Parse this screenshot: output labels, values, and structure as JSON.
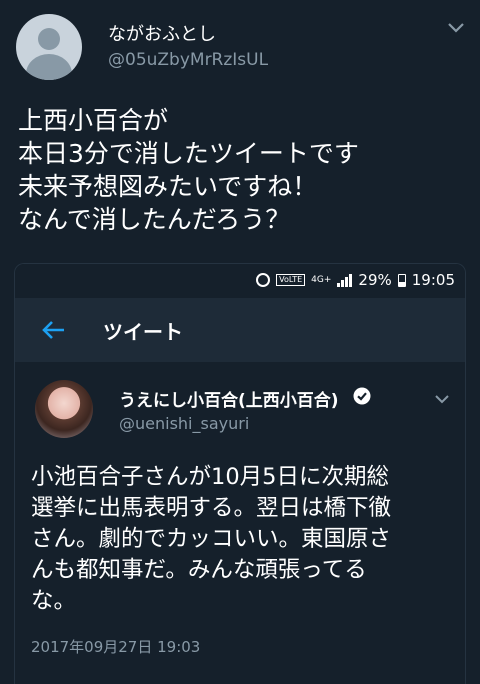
{
  "tweet": {
    "display_name": "ながおふとし",
    "handle": "@05uZbyMrRzIsUL",
    "text_lines": [
      "上西小百合が",
      "本日3分で消したツイートです",
      "未来予想図みたいですね！",
      "なんで消したんだろう？"
    ],
    "avatar_icon": "default-profile-icon",
    "menu_icon": "chevron-down-icon"
  },
  "screenshot": {
    "status_bar": {
      "volte": "VoLTE",
      "network": "4G+",
      "battery": "29%",
      "time": "19:05"
    },
    "app_bar": {
      "title": "ツイート",
      "back_icon": "arrow-left-icon"
    },
    "inner_tweet": {
      "display_name": "うえにし小百合(上西小百合)",
      "handle": "@uenishi_sayuri",
      "text_lines": [
        "小池百合子さんが10月5日に次期総",
        "選挙に出馬表明する。翌日は橋下徹",
        "さん。劇的でカッコいい。東国原さ",
        "んも都知事だ。みんな頑張ってる",
        "な。"
      ],
      "timestamp": "2017年09月27日 19:03",
      "verified_icon": "verified-badge-icon"
    }
  },
  "colors": {
    "background": "#15202b",
    "app_bar": "#1e2b38",
    "accent": "#1da1f2",
    "secondary_text": "#8899a6"
  }
}
